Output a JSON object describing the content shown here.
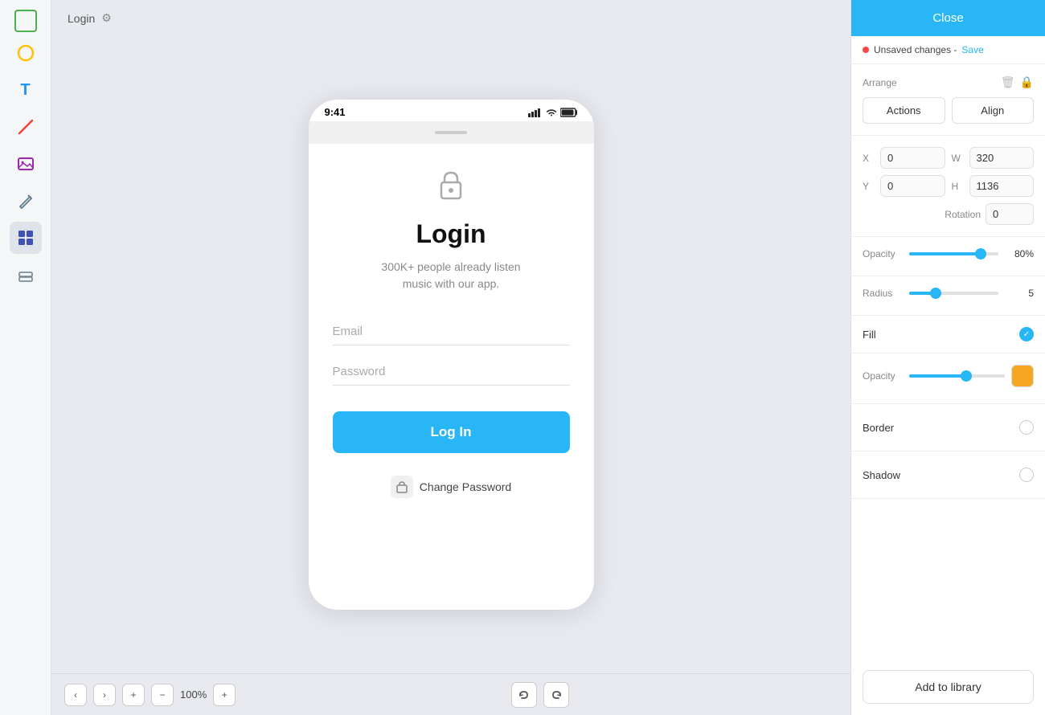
{
  "toolbar": {
    "tools": [
      {
        "name": "rectangle-tool",
        "icon": "□",
        "color": "#4CAF50"
      },
      {
        "name": "circle-tool",
        "icon": "○",
        "color": "#FFC107"
      },
      {
        "name": "text-tool",
        "icon": "T",
        "color": "#2196F3"
      },
      {
        "name": "line-tool",
        "icon": "/",
        "color": "#F44336"
      },
      {
        "name": "image-tool",
        "icon": "⊞",
        "color": "#9C27B0"
      },
      {
        "name": "pen-tool",
        "icon": "✏",
        "color": "#607D8B"
      },
      {
        "name": "components-tool",
        "icon": "⊞",
        "color": "#3F51B5"
      },
      {
        "name": "layers-tool",
        "icon": "▭",
        "color": "#78909C"
      }
    ]
  },
  "canvas": {
    "header_title": "Login",
    "page_title": "Login"
  },
  "phone": {
    "status_time": "9:41",
    "login_icon": "🔒",
    "login_title": "Login",
    "login_subtitle": "300K+ people already listen\nmusic with our app.",
    "email_placeholder": "Email",
    "password_placeholder": "Password",
    "login_btn_label": "Log In",
    "change_password_label": "Change Password"
  },
  "footer": {
    "prev_label": "‹",
    "next_label": "›",
    "add_label": "+",
    "zoom_minus": "−",
    "zoom_value": "100%",
    "zoom_plus": "+",
    "undo_label": "↩",
    "redo_label": "↪"
  },
  "panel": {
    "close_label": "Close",
    "unsaved_text": "Unsaved changes -",
    "save_label": "Save",
    "arrange_label": "Arrange",
    "actions_label": "Actions",
    "align_label": "Align",
    "x_label": "X",
    "x_value": "0",
    "y_label": "Y",
    "y_value": "0",
    "w_label": "W",
    "w_value": "320",
    "h_label": "H",
    "h_value": "1136",
    "rotation_label": "Rotation",
    "rotation_value": "0",
    "opacity_label": "Opacity",
    "opacity_value": "80%",
    "opacity_percent": 80,
    "radius_label": "Radius",
    "radius_value": "5",
    "radius_percent": 30,
    "fill_label": "Fill",
    "fill_active": true,
    "fill_opacity_label": "Opacity",
    "fill_color": "#f5a623",
    "border_label": "Border",
    "shadow_label": "Shadow",
    "add_library_label": "Add to library",
    "colors": {
      "accent": "#29b6f6",
      "unsaved_dot": "#f44336",
      "fill_swatch": "#f5a623"
    }
  }
}
